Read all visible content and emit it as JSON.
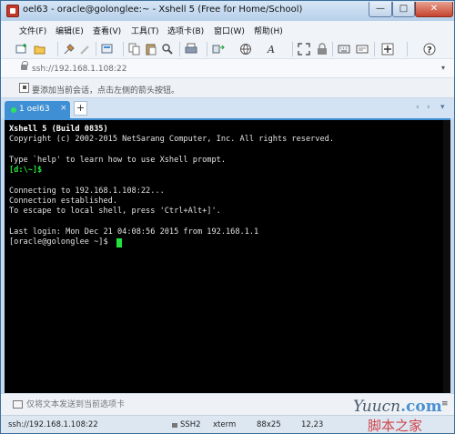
{
  "window": {
    "title": "oel63 - oracle@golonglee:~ - Xshell 5 (Free for Home/School)",
    "min_label": "—",
    "max_label": "□",
    "close_label": "✕"
  },
  "menu": [
    {
      "name": "menu-file",
      "label": "文件(F)"
    },
    {
      "name": "menu-edit",
      "label": "编辑(E)"
    },
    {
      "name": "menu-view",
      "label": "查看(V)"
    },
    {
      "name": "menu-tools",
      "label": "工具(T)"
    },
    {
      "name": "menu-tab",
      "label": "选项卡(B)"
    },
    {
      "name": "menu-window",
      "label": "窗口(W)"
    },
    {
      "name": "menu-help",
      "label": "帮助(H)"
    }
  ],
  "toolbar_icons": [
    "new-session-icon",
    "open-folder-icon",
    "disconnect-icon",
    "reconnect-icon",
    "properties-icon",
    "copy-icon",
    "paste-icon",
    "find-icon",
    "print-icon",
    "transfer-icon",
    "globe-icon",
    "font-icon",
    "fullscreen-icon",
    "lock-icon",
    "keyboard-icon",
    "compose-icon",
    "add-icon",
    "help-icon"
  ],
  "address": {
    "value": "ssh://192.168.1.108:22",
    "arrow": "▾"
  },
  "hint": {
    "text": "要添加当前会话，点击左侧的箭头按钮。"
  },
  "tabs": [
    {
      "label": "1 oel63",
      "close": "×"
    }
  ],
  "tab_add": "+",
  "tab_nav": {
    "prev": "‹",
    "next": "›",
    "menu": "▾"
  },
  "terminal": {
    "lines": [
      {
        "text": "Xshell 5 (Build 0835)",
        "style": "bold"
      },
      {
        "text": "Copyright (c) 2002-2015 NetSarang Computer, Inc. All rights reserved.",
        "style": ""
      },
      {
        "text": "",
        "style": ""
      },
      {
        "text": "Type `help' to learn how to use Xshell prompt.",
        "style": ""
      },
      {
        "text": "[d:\\~]$",
        "style": "green"
      },
      {
        "text": "",
        "style": ""
      },
      {
        "text": "Connecting to 192.168.1.108:22...",
        "style": ""
      },
      {
        "text": "Connection established.",
        "style": ""
      },
      {
        "text": "To escape to local shell, press 'Ctrl+Alt+]'.",
        "style": ""
      },
      {
        "text": "",
        "style": ""
      },
      {
        "text": "Last login: Mon Dec 21 04:08:56 2015 from 192.168.1.1",
        "style": ""
      },
      {
        "text": "[oracle@golonglee ~]$",
        "style": ""
      }
    ]
  },
  "compose": {
    "text": "仅将文本发送到当前选项卡",
    "menu": "≡"
  },
  "status": {
    "address": "ssh://192.168.1.108:22",
    "protocol": "SSH2",
    "terminal_type": "xterm",
    "size": "88x25",
    "position": "12,23"
  },
  "watermark": {
    "logo": "Yuucn",
    "logo_suffix": ".com",
    "sub": "脚本之家"
  },
  "colors": {
    "terminal_bg": "#000000",
    "prompt_green": "#22e33c",
    "tab_blue": "#3f8fd4"
  }
}
